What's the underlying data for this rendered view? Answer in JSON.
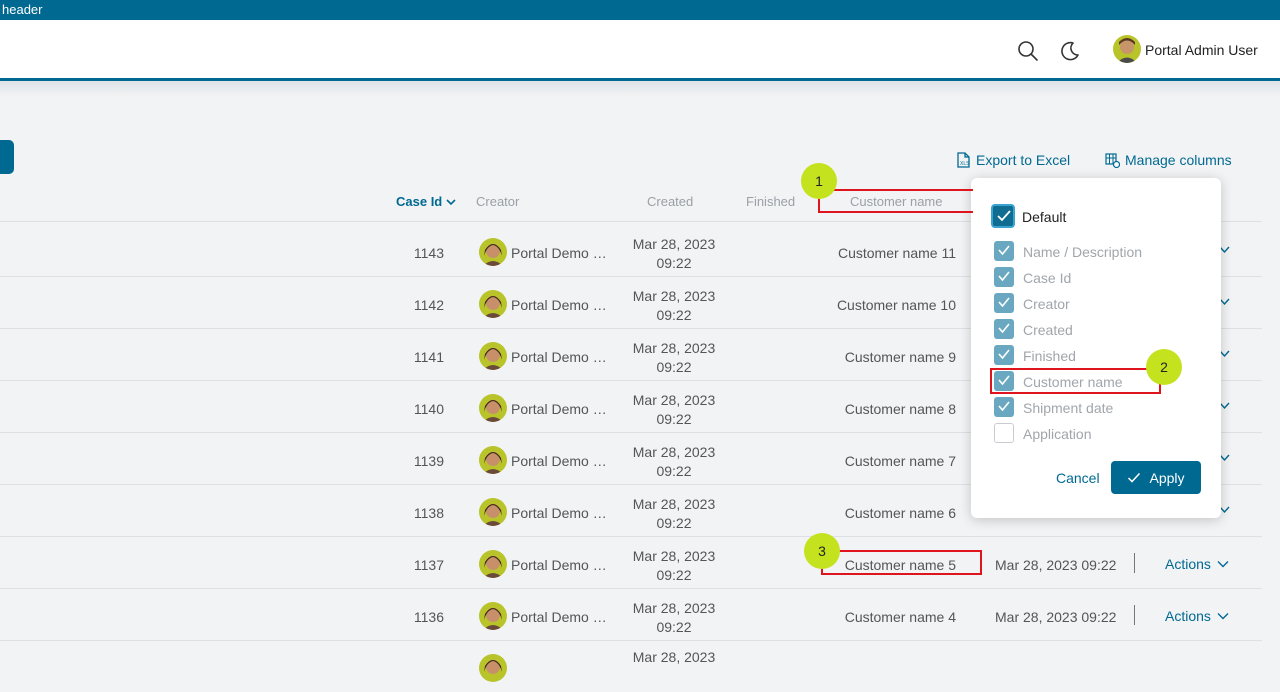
{
  "topbar": {
    "label": "header"
  },
  "header": {
    "user_name": "Portal Admin User"
  },
  "toolbar": {
    "export_label": "Export to Excel",
    "manage_label": "Manage columns"
  },
  "columns": {
    "case_id": "Case Id",
    "creator": "Creator",
    "created": "Created",
    "finished": "Finished",
    "customer_name": "Customer name"
  },
  "rows": [
    {
      "id": "1143",
      "creator": "Portal Demo User",
      "created_date": "Mar 28, 2023",
      "created_time": "09:22",
      "customer": "Customer name 11",
      "shipment": "",
      "actions": ""
    },
    {
      "id": "1142",
      "creator": "Portal Demo User",
      "created_date": "Mar 28, 2023",
      "created_time": "09:22",
      "customer": "Customer name 10",
      "shipment": "",
      "actions": ""
    },
    {
      "id": "1141",
      "creator": "Portal Demo User",
      "created_date": "Mar 28, 2023",
      "created_time": "09:22",
      "customer": "Customer name 9",
      "shipment": "",
      "actions": ""
    },
    {
      "id": "1140",
      "creator": "Portal Demo User",
      "created_date": "Mar 28, 2023",
      "created_time": "09:22",
      "customer": "Customer name 8",
      "shipment": "",
      "actions": ""
    },
    {
      "id": "1139",
      "creator": "Portal Demo User",
      "created_date": "Mar 28, 2023",
      "created_time": "09:22",
      "customer": "Customer name 7",
      "shipment": "",
      "actions": ""
    },
    {
      "id": "1138",
      "creator": "Portal Demo User",
      "created_date": "Mar 28, 2023",
      "created_time": "09:22",
      "customer": "Customer name 6",
      "shipment": "",
      "actions": ""
    },
    {
      "id": "1137",
      "creator": "Portal Demo User",
      "created_date": "Mar 28, 2023",
      "created_time": "09:22",
      "customer": "Customer name 5",
      "shipment": "Mar 28, 2023 09:22",
      "actions": "Actions"
    },
    {
      "id": "1136",
      "creator": "Portal Demo User",
      "created_date": "Mar 28, 2023",
      "created_time": "09:22",
      "customer": "Customer name 4",
      "shipment": "Mar 28, 2023 09:22",
      "actions": "Actions"
    },
    {
      "id": "",
      "creator": "",
      "created_date": "Mar 28, 2023",
      "created_time": "",
      "customer": "",
      "shipment": "",
      "actions": ""
    }
  ],
  "manage_popup": {
    "default_label": "Default",
    "options": [
      {
        "label": "Name / Description",
        "checked": true
      },
      {
        "label": "Case Id",
        "checked": true
      },
      {
        "label": "Creator",
        "checked": true
      },
      {
        "label": "Created",
        "checked": true
      },
      {
        "label": "Finished",
        "checked": true
      },
      {
        "label": "Customer name",
        "checked": true
      },
      {
        "label": "Shipment date",
        "checked": true
      },
      {
        "label": "Application",
        "checked": false
      }
    ],
    "cancel_label": "Cancel",
    "apply_label": "Apply"
  },
  "callouts": [
    "1",
    "2",
    "3"
  ],
  "colors": {
    "primary": "#006992",
    "callout": "#c5e21e",
    "highlight": "#e0141e"
  }
}
